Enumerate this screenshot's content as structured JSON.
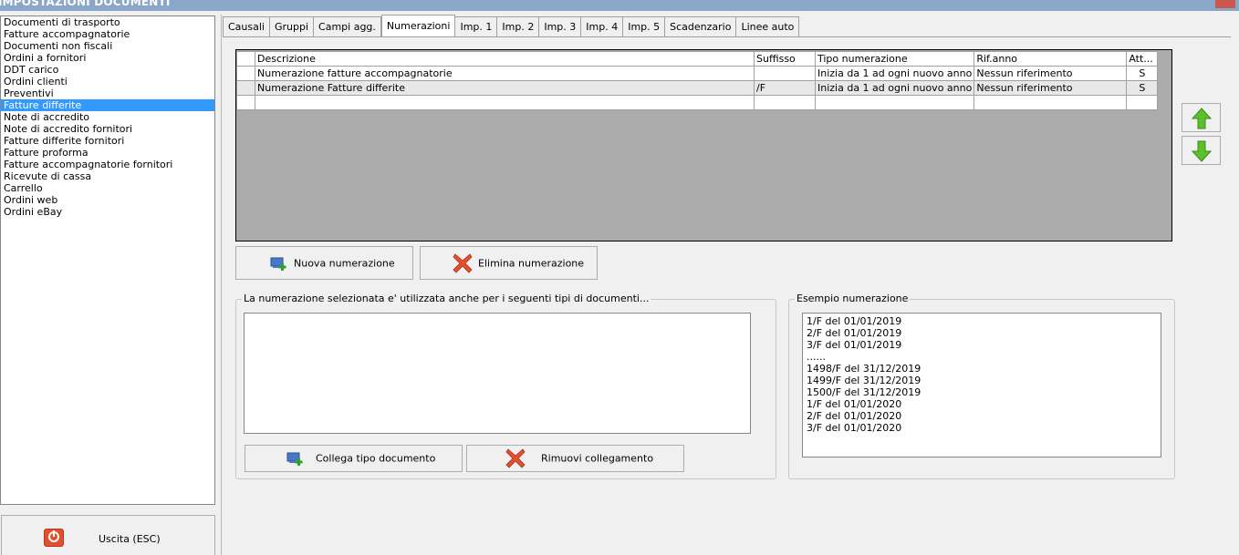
{
  "window": {
    "title": "IMPOSTAZIONI DOCUMENTI"
  },
  "sidebar": {
    "items": [
      "Documenti di trasporto",
      "Fatture accompagnatorie",
      "Documenti non fiscali",
      "Ordini a fornitori",
      "DDT carico",
      "Ordini clienti",
      "Preventivi",
      "Fatture differite",
      "Note di accredito",
      "Note di accredito fornitori",
      "Fatture differite fornitori",
      "Fatture proforma",
      "Fatture accompagnatorie fornitori",
      "Ricevute di cassa",
      "Carrello",
      "Ordini web",
      "Ordini eBay"
    ],
    "selected": "Fatture differite"
  },
  "exit_button": {
    "label": "Uscita (ESC)"
  },
  "tabs": [
    "Causali",
    "Gruppi",
    "Campi agg.",
    "Numerazioni",
    "Imp. 1",
    "Imp. 2",
    "Imp. 3",
    "Imp. 4",
    "Imp. 5",
    "Scadenzario",
    "Linee auto"
  ],
  "active_tab": "Numerazioni",
  "grid": {
    "columns": [
      "Descrizione",
      "Suffisso",
      "Tipo numerazione",
      "Rif.anno",
      "Att..."
    ],
    "rows": [
      [
        "Numerazione fatture accompagnatorie",
        "",
        "Inizia da 1 ad ogni nuovo anno",
        "Nessun riferimento",
        "S"
      ],
      [
        "Numerazione Fatture differite",
        "/F",
        "Inizia da 1 ad ogni nuovo anno",
        "Nessun riferimento",
        "S"
      ],
      [
        "",
        "",
        "",
        "",
        ""
      ]
    ]
  },
  "buttons": {
    "new": "Nuova numerazione",
    "delete": "Elimina numerazione",
    "link": "Collega tipo documento",
    "unlink": "Rimuovi collegamento"
  },
  "linked_group": {
    "label": "La numerazione selezionata e' utilizzata anche per i seguenti tipi di documenti..."
  },
  "example_group": {
    "label": "Esempio numerazione",
    "lines": [
      "1/F del 01/01/2019",
      "2/F del 01/01/2019",
      "3/F del 01/01/2019",
      "......",
      "1498/F del 31/12/2019",
      "1499/F del 31/12/2019",
      "1500/F del 31/12/2019",
      "1/F del 01/01/2020",
      "2/F del 01/01/2020",
      "3/F del 01/01/2020"
    ]
  },
  "icons": {
    "up": "arrow-up-icon",
    "down": "arrow-down-icon",
    "add": "add-icon",
    "delete": "delete-x-icon",
    "exit": "power-icon"
  },
  "colors": {
    "selection": "#3399ff",
    "arrow_green": "#5cc02c",
    "delete_red": "#e2502e",
    "grid_background": "#ababab"
  }
}
